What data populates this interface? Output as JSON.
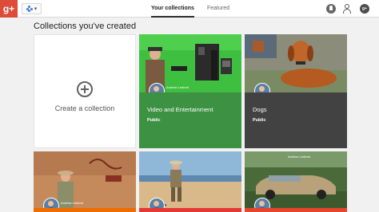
{
  "header": {
    "logo_text": "g+",
    "tabs": [
      {
        "label": "Your collections",
        "active": true
      },
      {
        "label": "Featured",
        "active": false
      }
    ],
    "icons": [
      "notifications-icon",
      "add-person-icon",
      "share-icon"
    ],
    "accent": "#dd4b39"
  },
  "section": {
    "title": "Collections you've created"
  },
  "create": {
    "label": "Create a collection"
  },
  "collections": [
    {
      "name": "Video and Entertainment",
      "visibility": "Public",
      "color": "#3c9143",
      "owner": "Andrew Ledford"
    },
    {
      "name": "Dogs",
      "visibility": "Public",
      "color": "#424242",
      "owner": ""
    },
    {
      "name": "",
      "visibility": "",
      "color": "#ef6c00",
      "owner": "Andrew Ledford"
    },
    {
      "name": "",
      "visibility": "",
      "color": "#e53935",
      "owner": ""
    },
    {
      "name": "",
      "visibility": "",
      "color": "#e6452c",
      "owner": "Andrew Ledford"
    }
  ]
}
